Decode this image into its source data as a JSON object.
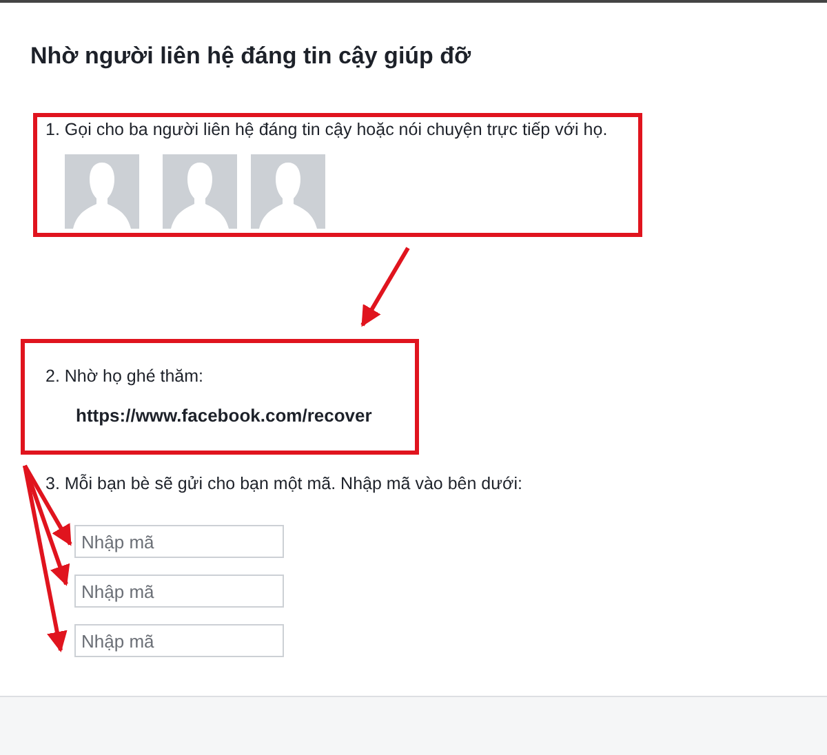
{
  "title": "Nhờ người liên hệ đáng tin cậy giúp đỡ",
  "steps": [
    {
      "kind": "contacts",
      "highlighted": true,
      "text": "1. Gọi cho ba người liên hệ đáng tin cậy hoặc nói chuyện trực tiếp với họ.",
      "contacts": [
        {
          "kind": "avatar"
        },
        {
          "kind": "avatar"
        },
        {
          "kind": "avatar"
        }
      ]
    },
    {
      "kind": "link",
      "highlighted": true,
      "text": "2. Nhờ họ ghé thăm:",
      "link": "https://www.facebook.com/recover"
    },
    {
      "kind": "codes",
      "highlighted": false,
      "text": "3. Mỗi bạn bè sẽ gửi cho bạn một mã. Nhập mã vào bên dưới:",
      "fields": [
        {
          "placeholder": "Nhập mã"
        },
        {
          "placeholder": "Nhập mã"
        },
        {
          "placeholder": "Nhập mã"
        }
      ]
    }
  ]
}
